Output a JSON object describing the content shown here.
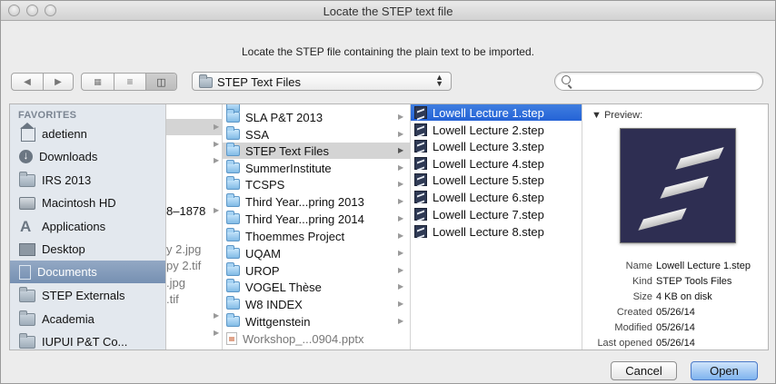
{
  "window": {
    "title": "Locate the STEP text file",
    "prompt": "Locate the STEP file containing the plain text to be imported."
  },
  "toolbar": {
    "back_icon": "back-arrow-icon",
    "forward_icon": "forward-arrow-icon",
    "views": [
      "icon-view",
      "list-view",
      "column-view"
    ],
    "location": "STEP Text Files",
    "search_placeholder": ""
  },
  "sidebar": {
    "heading": "FAVORITES",
    "items": [
      {
        "label": "adetienn",
        "icon": "home-icon"
      },
      {
        "label": "Downloads",
        "icon": "downloads-icon"
      },
      {
        "label": "IRS 2013",
        "icon": "folder-icon"
      },
      {
        "label": "Macintosh HD",
        "icon": "hard-drive-icon"
      },
      {
        "label": "Applications",
        "icon": "applications-icon"
      },
      {
        "label": "Desktop",
        "icon": "desktop-icon"
      },
      {
        "label": "Documents",
        "icon": "documents-icon"
      },
      {
        "label": "STEP Externals",
        "icon": "folder-icon"
      },
      {
        "label": "Academia",
        "icon": "folder-icon"
      },
      {
        "label": "IUPUI P&T Co...",
        "icon": "folder-icon"
      }
    ]
  },
  "column1": {
    "fragments": [
      "8–1878",
      "y 2.jpg",
      "py 2.tif",
      ".jpg",
      ".tif"
    ]
  },
  "column2": {
    "items": [
      "SLA P&T 2013",
      "SSA",
      "STEP Text Files",
      "SummerInstitute",
      "TCSPS",
      "Third Year...pring 2013",
      "Third Year...pring 2014",
      "Thoemmes Project",
      "UQAM",
      "UROP",
      "VOGEL Thèse",
      "W8 INDEX",
      "Wittgenstein",
      "Workshop_...0904.pptx"
    ]
  },
  "column3": {
    "items": [
      "Lowell Lecture 1.step",
      "Lowell Lecture 2.step",
      "Lowell Lecture 3.step",
      "Lowell Lecture 4.step",
      "Lowell Lecture 5.step",
      "Lowell Lecture 6.step",
      "Lowell Lecture 7.step",
      "Lowell Lecture 8.step"
    ]
  },
  "preview": {
    "heading": "Preview:",
    "meta": [
      {
        "key": "Name",
        "value": "Lowell Lecture 1.step"
      },
      {
        "key": "Kind",
        "value": "STEP Tools Files"
      },
      {
        "key": "Size",
        "value": "4 KB on disk"
      },
      {
        "key": "Created",
        "value": "05/26/14"
      },
      {
        "key": "Modified",
        "value": "05/26/14"
      },
      {
        "key": "Last opened",
        "value": "05/26/14"
      }
    ]
  },
  "buttons": {
    "cancel": "Cancel",
    "open": "Open"
  }
}
